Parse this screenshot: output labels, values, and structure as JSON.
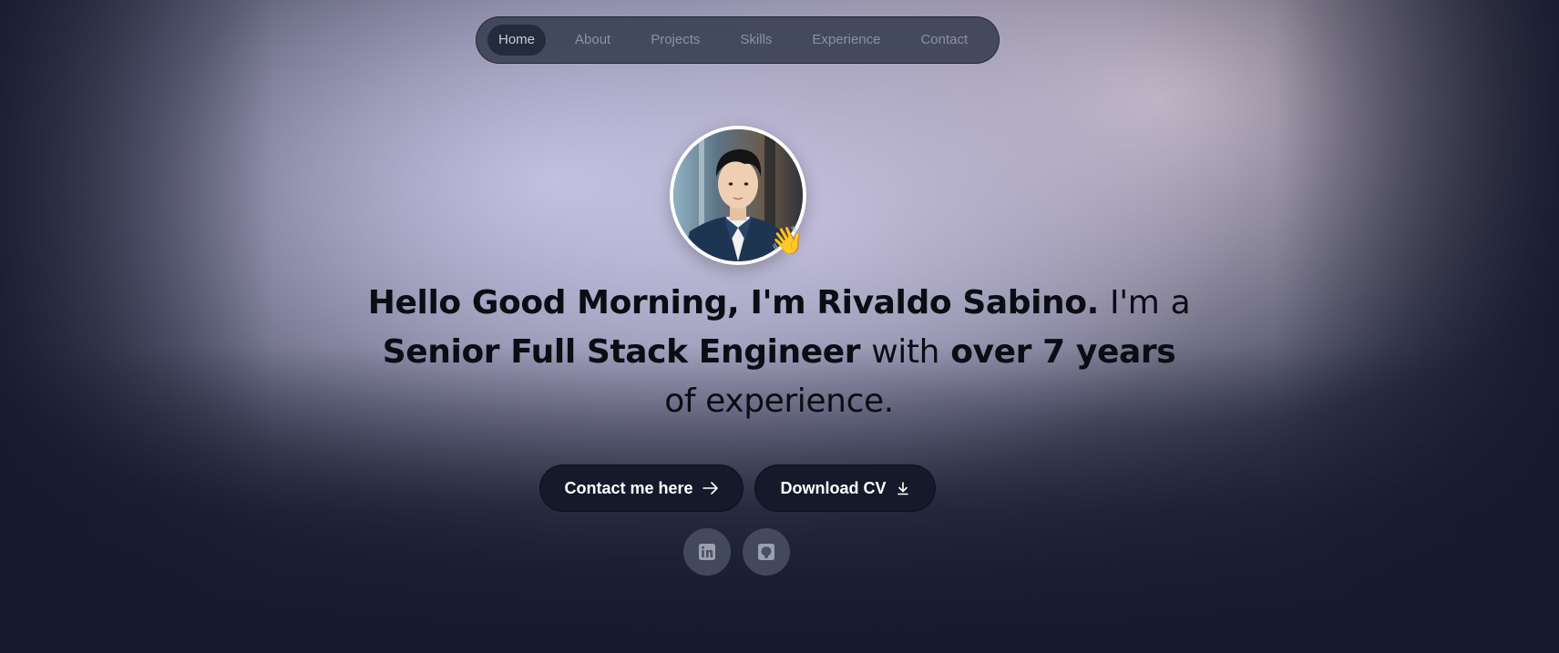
{
  "nav": {
    "items": [
      {
        "label": "Home",
        "active": true
      },
      {
        "label": "About",
        "active": false
      },
      {
        "label": "Projects",
        "active": false
      },
      {
        "label": "Skills",
        "active": false
      },
      {
        "label": "Experience",
        "active": false
      },
      {
        "label": "Contact",
        "active": false
      }
    ]
  },
  "hero": {
    "wave_emoji": "👋",
    "headline": {
      "greeting": "Hello Good Morning, I'm Rivaldo Sabino.",
      "im": "I'm",
      "a": "a",
      "role": "Senior Full Stack Engineer",
      "with": "with",
      "years": "over 7 years",
      "rest": "of experience."
    },
    "buttons": {
      "contact_label": "Contact me here",
      "cv_label": "Download CV"
    }
  },
  "social": {
    "linkedin_icon": "linkedin-icon",
    "github_icon": "github-icon"
  },
  "colors": {
    "button_bg": "#141a2a",
    "nav_bg": "#373e50",
    "text": "#0b0d14"
  }
}
